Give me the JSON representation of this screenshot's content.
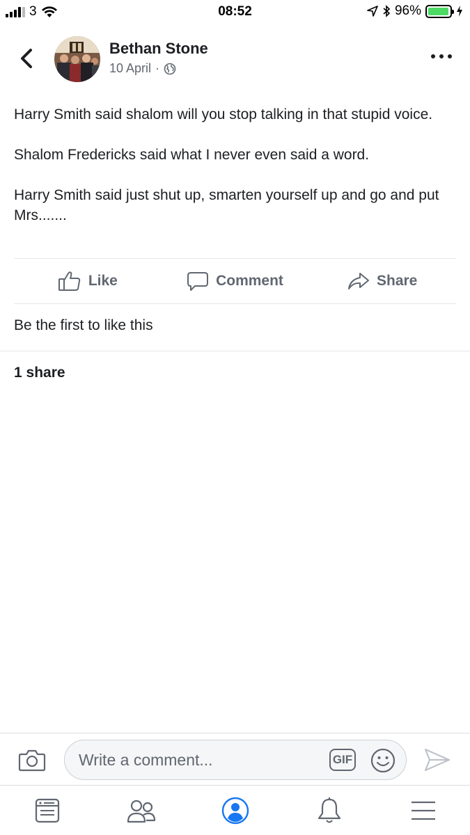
{
  "status_bar": {
    "carrier": "3",
    "time": "08:52",
    "battery_percent": "96%",
    "battery_level": 0.96,
    "icons": [
      "signal-icon",
      "wifi-icon",
      "location-icon",
      "bluetooth-icon",
      "battery-icon",
      "charging-icon"
    ]
  },
  "post": {
    "author": "Bethan Stone",
    "date": "10 April",
    "separator": "·",
    "privacy_icon": "globe-icon",
    "paragraphs": [
      "Harry Smith said shalom will you stop talking in that stupid voice.",
      "Shalom Fredericks said what I never even said a word.",
      "Harry Smith said just shut up, smarten yourself up and go and put Mrs......."
    ]
  },
  "actions": {
    "like": "Like",
    "comment": "Comment",
    "share": "Share"
  },
  "reactions": {
    "likes_text": "Be the first to like this",
    "shares_text": "1 share"
  },
  "comment_bar": {
    "placeholder": "Write a comment...",
    "gif_label": "GIF"
  },
  "tab_bar": {
    "tabs": [
      "news-feed-icon",
      "friends-icon",
      "profile-icon",
      "notifications-icon",
      "menu-icon"
    ],
    "active_tab": "profile-icon",
    "active_color": "#1877f2",
    "inactive_color": "#606770"
  }
}
